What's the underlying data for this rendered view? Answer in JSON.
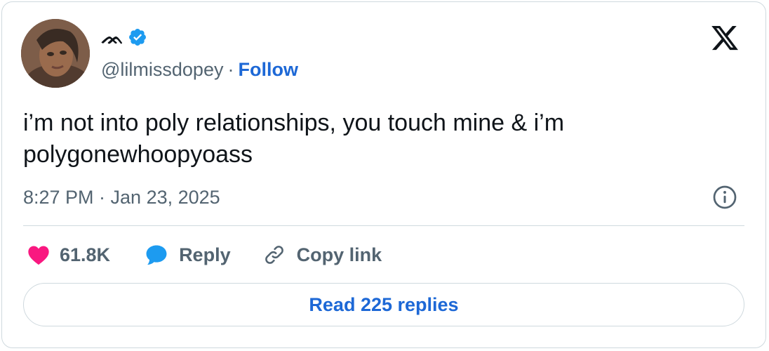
{
  "author": {
    "display_name": "ᨏ",
    "handle": "@lilmissdopey",
    "follow_label": "Follow",
    "separator": "·",
    "verified_color": "#1d9bf0"
  },
  "tweet": {
    "text": "i’m not into poly relationships, you touch mine & i’m\npolygonewhoopyoass",
    "timestamp": "8:27 PM · Jan 23, 2025"
  },
  "actions": {
    "like_count": "61.8K",
    "reply_label": "Reply",
    "copy_link_label": "Copy link"
  },
  "read_replies_label": "Read 225 replies",
  "icons": {
    "brand": "x-logo-icon",
    "verified": "verified-badge-icon",
    "info": "info-icon",
    "like": "heart-icon",
    "reply": "speech-bubble-icon",
    "copy": "link-icon"
  },
  "colors": {
    "accent": "#1d68d6",
    "like": "#f91880",
    "reply": "#1d9bf0",
    "muted": "#536471",
    "border": "#cfd9de"
  }
}
